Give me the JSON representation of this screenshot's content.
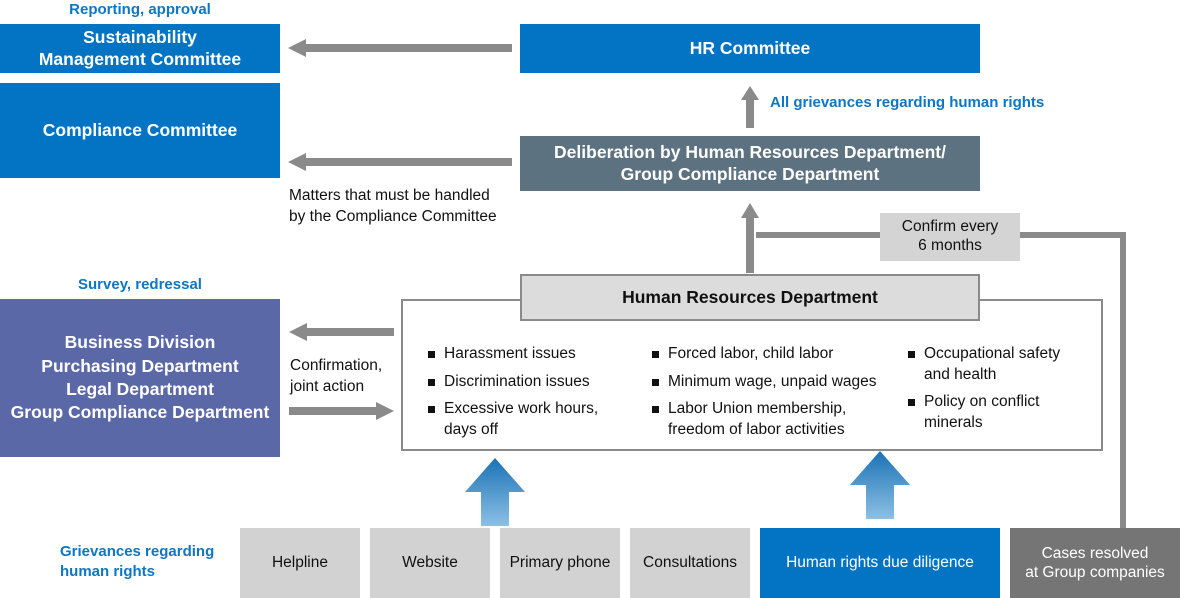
{
  "diagram": {
    "title": "Human rights grievance handling and reporting flow",
    "colors": {
      "brand_blue": "#0374c4",
      "label_blue": "#0e76c4",
      "slate": "#5d7280",
      "periwinkle": "#5b68a8",
      "light_gray": "#d2d2d2",
      "dark_gray": "#757575",
      "arrow_gray": "#8a8a8a"
    }
  },
  "labels": {
    "reporting_approval": "Reporting, approval",
    "all_grievances": "All grievances regarding human rights",
    "matters_compliance": "Matters that must be handled\nby the Compliance Committee",
    "matters_compliance_line1": "Matters that must be handled",
    "matters_compliance_line2": "by the Compliance Committee",
    "survey_redressal": "Survey, redressal",
    "confirmation_joint_line1": "Confirmation,",
    "confirmation_joint_line2": "joint action",
    "grievances_line1": "Grievances regarding",
    "grievances_line2": "human rights",
    "confirm_every_line1": "Confirm every",
    "confirm_every_line2": "6 months"
  },
  "committees": {
    "sustainability_line1": "Sustainability",
    "sustainability_line2": "Management Committee",
    "compliance": "Compliance Committee",
    "hr_committee": "HR Committee"
  },
  "deliberation": {
    "line1": "Deliberation by Human Resources Department/",
    "line2": "Group Compliance Department"
  },
  "departments": {
    "items": [
      "Business Division",
      "Purchasing Department",
      "Legal Department",
      "Group Compliance Department"
    ]
  },
  "hr_department": {
    "header": "Human Resources Department",
    "columns": [
      {
        "items": [
          "Harassment issues",
          "Discrimination issues",
          "Excessive work hours,\ndays off"
        ]
      },
      {
        "items": [
          "Forced labor, child labor",
          "Minimum wage, unpaid wages",
          "Labor Union membership,\nfreedom of labor activities"
        ]
      },
      {
        "items": [
          "Occupational safety\nand health",
          "Policy on conflict\nminerals"
        ]
      }
    ]
  },
  "channels": [
    {
      "label": "Helpline",
      "style": "gray"
    },
    {
      "label": "Website",
      "style": "gray"
    },
    {
      "label": "Primary phone",
      "style": "gray"
    },
    {
      "label": "Consultations",
      "style": "gray"
    },
    {
      "label": "Human rights due diligence",
      "style": "blue"
    },
    {
      "label": "Cases resolved\nat Group companies",
      "style": "darkgray"
    }
  ],
  "channels_flat": {
    "helpline": "Helpline",
    "website": "Website",
    "primary_phone": "Primary phone",
    "consultations": "Consultations",
    "due_diligence": "Human rights due diligence",
    "cases_resolved_line1": "Cases resolved",
    "cases_resolved_line2": "at Group companies"
  }
}
